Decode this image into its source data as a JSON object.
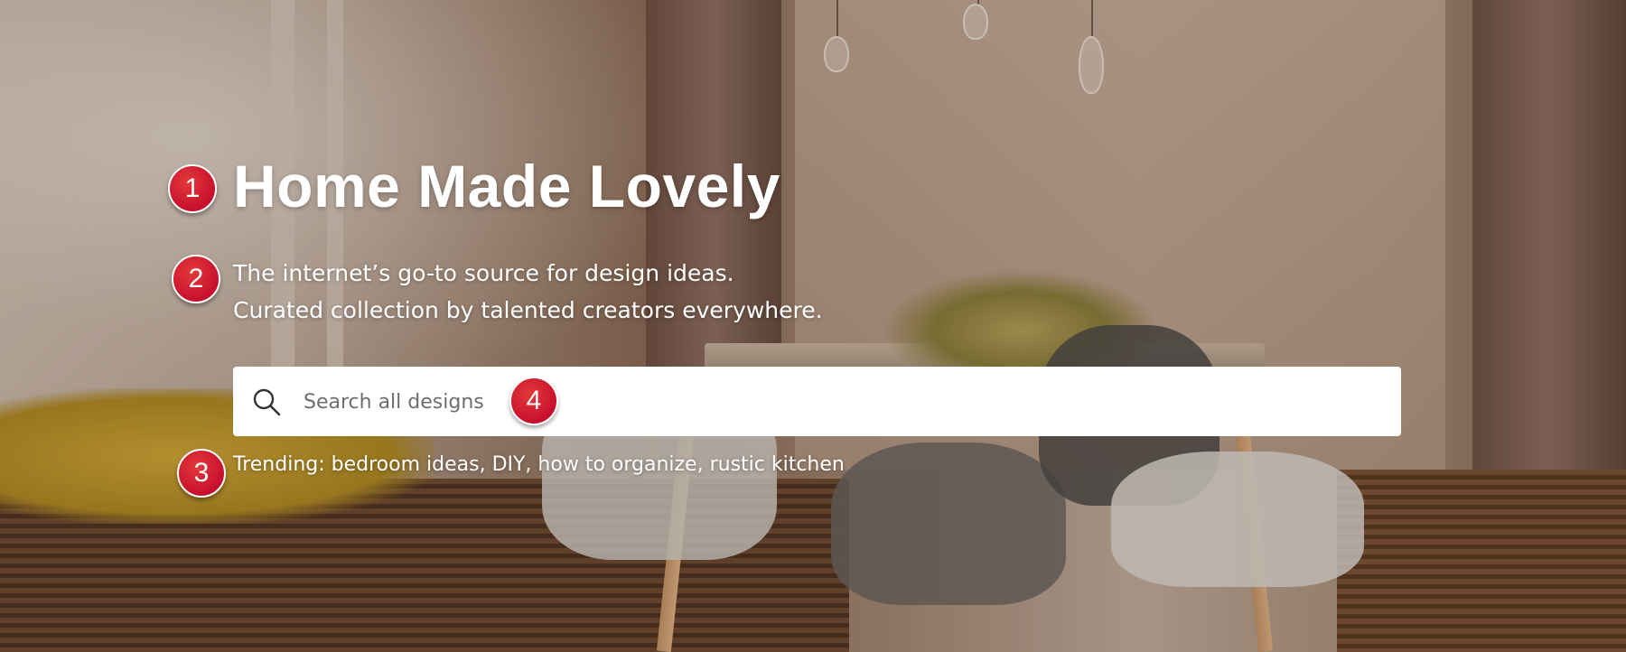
{
  "hero": {
    "title": "Home Made Lovely",
    "subtitle_line1": "The internet’s go-to source for design ideas.",
    "subtitle_line2": "Curated collection by talented creators everywhere.",
    "search": {
      "placeholder": "Search all designs",
      "icon": "search-icon"
    },
    "trending_label": "Trending:",
    "trending_items": "bedroom ideas, DIY, how to organize, rustic kitchen"
  },
  "annotations": {
    "badge_1": "1",
    "badge_2": "2",
    "badge_3": "3",
    "badge_4": "4",
    "color": "#c8102e"
  }
}
